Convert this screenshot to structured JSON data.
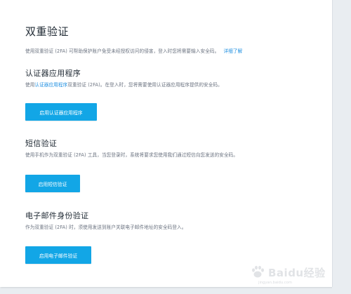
{
  "page": {
    "title": "双重验证",
    "intro": "使用双重验证 (2FA) 可帮助保护账户免受未经授权访问的侵害，登入时您将需要输入安全码。",
    "intro_link": "详细了解"
  },
  "sections": [
    {
      "title": "认证器应用程序",
      "desc_prefix": "使用",
      "desc_link": "认证器应用程序",
      "desc_suffix": "双重验证 (2FA)。在登入时，您将需要使用认证器应用程序提供的安全码。",
      "button": "启用认证器应用程序"
    },
    {
      "title": "短信验证",
      "desc": "使用手机作为双重验证 (2FA) 工具，当您登录时，系统将要求您使用我们通过短信向您发送的安全码。",
      "button": "启用短信验证"
    },
    {
      "title": "电子邮件身份验证",
      "desc": "作为双重验证 (2FA) 时，须使用发送到账户关联电子邮件地址的安全码登入。",
      "button": "启用电子邮件验证"
    }
  ],
  "watermark": {
    "text": "Baidu经验",
    "sub": "jingyan.baidu.com"
  },
  "colors": {
    "accent": "#12a6e6",
    "link": "#1e8fe1",
    "background": "#e9edf1"
  }
}
